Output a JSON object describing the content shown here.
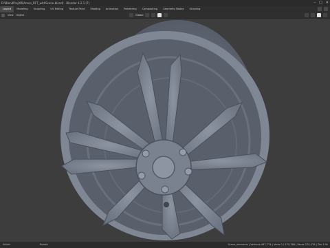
{
  "window": {
    "title": "D:\\BlendProj\\06\\Amon_RF7_withScene.blend) - Blender 4.2.1 (7)"
  },
  "workspace_tabs": [
    {
      "label": "Layout",
      "active": true
    },
    {
      "label": "Modeling",
      "active": false
    },
    {
      "label": "Sculpting",
      "active": false
    },
    {
      "label": "UV Editing",
      "active": false
    },
    {
      "label": "Texture Paint",
      "active": false
    },
    {
      "label": "Shading",
      "active": false
    },
    {
      "label": "Animation",
      "active": false
    },
    {
      "label": "Rendering",
      "active": false
    },
    {
      "label": "Compositing",
      "active": false
    },
    {
      "label": "Geometry Nodes",
      "active": false
    },
    {
      "label": "Scripting",
      "active": false
    }
  ],
  "header": {
    "view_menu": "View",
    "object_menu": "Object",
    "transform_orientation": "Global"
  },
  "statusbar": {
    "left_hint": "Select",
    "mid_hint": "Rotate",
    "stats": "Scene_elements | Vertices 497,774 | Verts 0 / 274,768 | Faces 274,276 | Tris 3.5k"
  },
  "colors": {
    "viewport_bg": "#3d3d3d",
    "wheel_body": "#7e8694",
    "wheel_dark": "#4f5561"
  }
}
